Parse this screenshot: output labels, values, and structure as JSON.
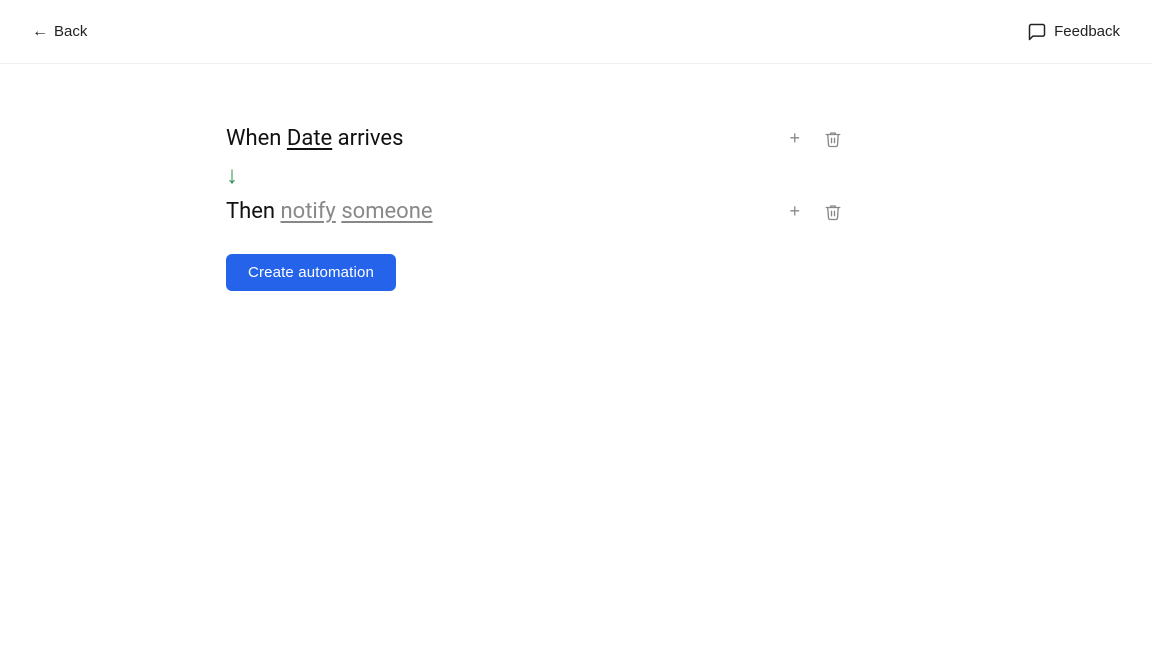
{
  "topbar": {
    "back_label": "Back",
    "feedback_label": "Feedback"
  },
  "automation": {
    "when_row": {
      "prefix": "When",
      "trigger_word": "Date",
      "suffix": " arrives",
      "add_label": "+",
      "delete_label": "🗑"
    },
    "then_row": {
      "prefix": "Then ",
      "action_word": "notify",
      "target_word": "someone",
      "add_label": "+",
      "delete_label": "🗑"
    },
    "create_button_label": "Create automation"
  }
}
